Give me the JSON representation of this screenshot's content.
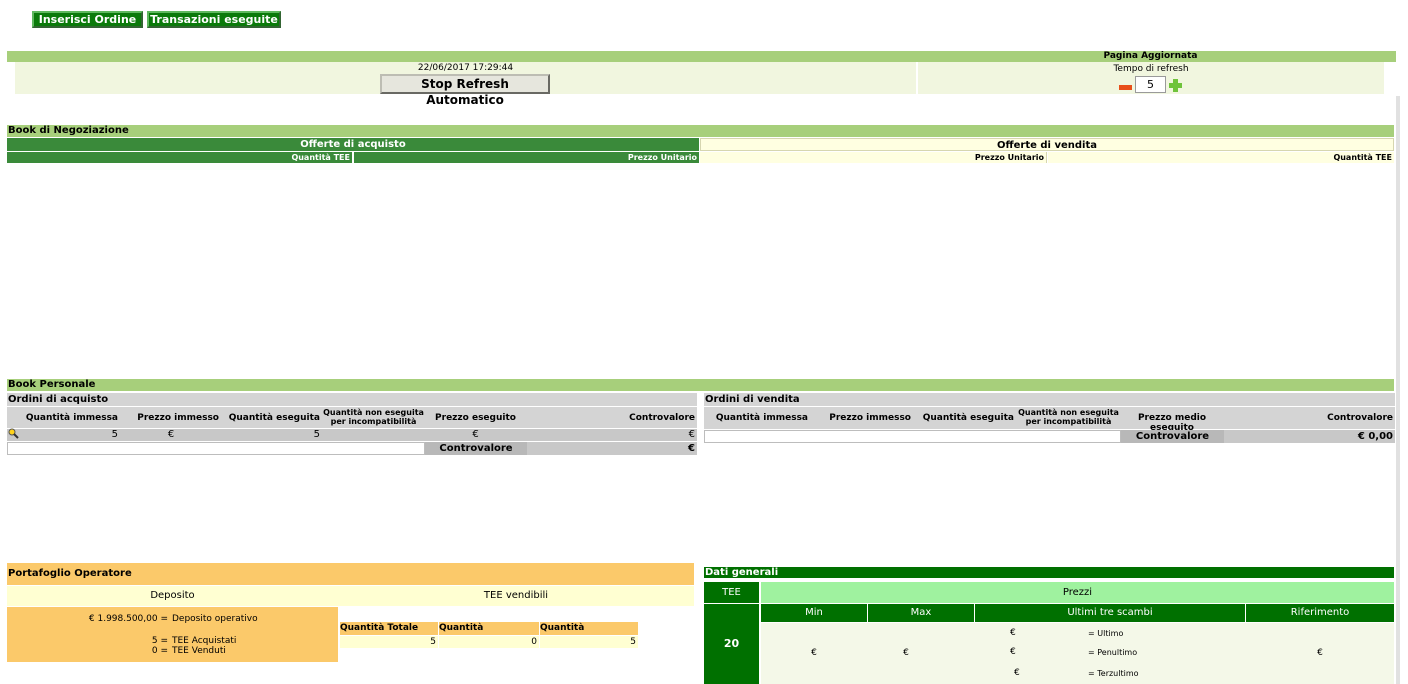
{
  "top_buttons": {
    "insert_order": "Inserisci Ordine",
    "transactions": "Transazioni eseguite"
  },
  "refresh": {
    "page_updated": "Pagina Aggiornata",
    "datetime": "22/06/2017 17:29:44",
    "stop_button": "Stop Refresh Automatico",
    "refresh_time_label": "Tempo di refresh",
    "refresh_value": "5"
  },
  "book_negoziazione": {
    "title": "Book di Negoziazione",
    "buy_header": "Offerte di acquisto",
    "sell_header": "Offerte di vendita",
    "buy_cols": [
      "Quantità TEE",
      "Prezzo Unitario"
    ],
    "sell_cols": [
      "Prezzo Unitario",
      "Quantità TEE"
    ]
  },
  "book_personale": {
    "title": "Book Personale",
    "buy": {
      "title": "Ordini di acquisto",
      "cols": [
        "Quantità immessa",
        "Prezzo immesso",
        "Quantità eseguita",
        "Quantità non eseguita per incompatibilità",
        "Prezzo eseguito",
        "Controvalore"
      ],
      "row": [
        "5",
        "€",
        "5",
        "",
        "€",
        "€"
      ],
      "total_label": "Controvalore",
      "total_value": "€"
    },
    "sell": {
      "title": "Ordini di vendita",
      "cols": [
        "Quantità immessa",
        "Prezzo immesso",
        "Quantità eseguita",
        "Quantità non eseguita per incompatibilità",
        "Prezzo medio eseguito",
        "Controvalore"
      ],
      "total_label": "Controvalore",
      "total_value": "€ 0,00"
    }
  },
  "portafoglio": {
    "title": "Portafoglio Operatore",
    "deposito_header": "Deposito",
    "vendibili_header": "TEE vendibili",
    "deposit_amount": "€ 1.998.500,00 =",
    "deposit_label": "Deposito operativo",
    "acquistati_amount": "5 =",
    "acquistati_label": "TEE Acquistati",
    "venduti_amount": "0 =",
    "venduti_label": "TEE Venduti",
    "cols": [
      "Quantità Totale",
      "Quantità Impegnata",
      "Quantità Disponibile"
    ],
    "values": [
      "5",
      "0",
      "5"
    ]
  },
  "dati_generali": {
    "title": "Dati generali",
    "tee_header": "TEE",
    "prezzi_header": "Prezzi",
    "cols": [
      "Min",
      "Max",
      "Ultimi tre scambi",
      "Riferimento"
    ],
    "tee_value": "20",
    "min": "€",
    "max": "€",
    "riferimento": "€",
    "scambi": [
      {
        "value": "€",
        "label": "= Ultimo"
      },
      {
        "value": "€",
        "label": "= Penultimo"
      },
      {
        "value": "€",
        "label": "= Terzultimo"
      }
    ]
  },
  "colors": {
    "dark_green": "#3a8a3a",
    "light_green": "#a7cf7b",
    "orange": "#fbc96a",
    "cream": "#ffffe1"
  }
}
